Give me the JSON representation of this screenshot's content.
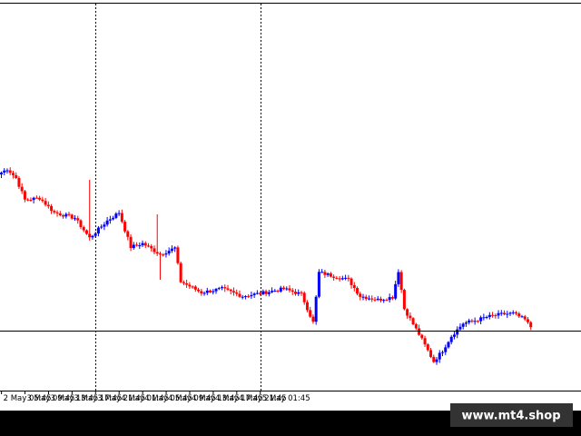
{
  "watermark": "www.mt4.shop",
  "colors": {
    "background": "#ffffff",
    "bull": "#0000ff",
    "bear": "#ff0000",
    "grid": "#000000",
    "bottom_bar": "#000000",
    "watermark_box": "#333333"
  },
  "chart_data": {
    "type": "candlestick",
    "title": "",
    "xlabel": "",
    "ylabel": "",
    "grid": false,
    "period_separators": [
      "3 May 21:45",
      "5 May 01:45"
    ],
    "horizontal_line": 66,
    "ylim": [
      0,
      430
    ],
    "x_tick_labels": [
      "2 May 05:45",
      "3 May 09:45",
      "3 May 13:45",
      "3 May 17:45",
      "3 May 21:45",
      "4 May 01:45",
      "4 May 05:45",
      "4 May 09:45",
      "4 May 13:45",
      "4 May 17:45",
      "4 May 21:45",
      "5 May 01:45"
    ],
    "candle_interval_minutes": 30,
    "close_path": [
      {
        "t": 0,
        "v": 240
      },
      {
        "t": 2,
        "v": 244
      },
      {
        "t": 5,
        "v": 234
      },
      {
        "t": 8,
        "v": 210
      },
      {
        "t": 13,
        "v": 212
      },
      {
        "t": 18,
        "v": 196
      },
      {
        "t": 25,
        "v": 190
      },
      {
        "t": 30,
        "v": 168
      },
      {
        "t": 36,
        "v": 187
      },
      {
        "t": 40,
        "v": 196
      },
      {
        "t": 44,
        "v": 158
      },
      {
        "t": 48,
        "v": 162
      },
      {
        "t": 54,
        "v": 150
      },
      {
        "t": 59,
        "v": 157
      },
      {
        "t": 61,
        "v": 120
      },
      {
        "t": 68,
        "v": 108
      },
      {
        "t": 75,
        "v": 112
      },
      {
        "t": 82,
        "v": 104
      },
      {
        "t": 88,
        "v": 107
      },
      {
        "t": 96,
        "v": 112
      },
      {
        "t": 102,
        "v": 106
      },
      {
        "t": 106,
        "v": 75
      },
      {
        "t": 108,
        "v": 130
      },
      {
        "t": 118,
        "v": 122
      },
      {
        "t": 122,
        "v": 104
      },
      {
        "t": 128,
        "v": 100
      },
      {
        "t": 133,
        "v": 103
      },
      {
        "t": 135,
        "v": 132
      },
      {
        "t": 137,
        "v": 90
      },
      {
        "t": 142,
        "v": 62
      },
      {
        "t": 147,
        "v": 32
      },
      {
        "t": 150,
        "v": 44
      },
      {
        "t": 153,
        "v": 60
      },
      {
        "t": 157,
        "v": 74
      },
      {
        "t": 161,
        "v": 77
      },
      {
        "t": 165,
        "v": 81
      },
      {
        "t": 170,
        "v": 84
      },
      {
        "t": 174,
        "v": 85
      },
      {
        "t": 178,
        "v": 78
      },
      {
        "t": 180,
        "v": 70
      }
    ],
    "spikes": [
      {
        "t": 30,
        "high": 232
      },
      {
        "t": 53,
        "high": 194
      },
      {
        "t": 54,
        "low": 122
      }
    ]
  }
}
